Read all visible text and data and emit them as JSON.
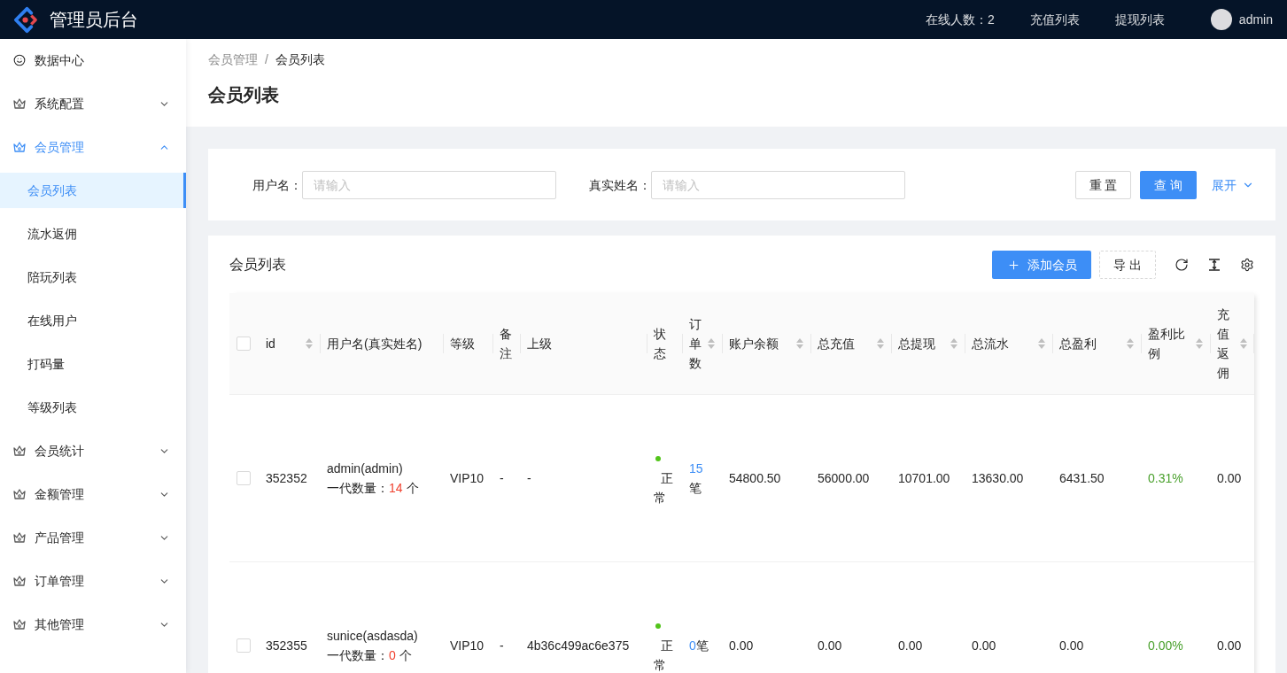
{
  "topbar": {
    "title": "管理员后台",
    "online": "在线人数：2",
    "links": [
      "充值列表",
      "提现列表"
    ],
    "user": "admin"
  },
  "sidebar": {
    "items": [
      {
        "kind": "link",
        "label": "数据中心",
        "selected": false
      },
      {
        "kind": "group",
        "label": "系统配置",
        "expanded": false
      },
      {
        "kind": "group",
        "label": "会员管理",
        "expanded": true,
        "children": [
          {
            "label": "会员列表",
            "selected": true
          },
          {
            "label": "流水返佣",
            "selected": false
          },
          {
            "label": "陪玩列表",
            "selected": false
          },
          {
            "label": "在线用户",
            "selected": false
          },
          {
            "label": "打码量",
            "selected": false
          },
          {
            "label": "等级列表",
            "selected": false
          }
        ]
      },
      {
        "kind": "group",
        "label": "会员统计",
        "expanded": false
      },
      {
        "kind": "group",
        "label": "金额管理",
        "expanded": false
      },
      {
        "kind": "group",
        "label": "产品管理",
        "expanded": false
      },
      {
        "kind": "group",
        "label": "订单管理",
        "expanded": false
      },
      {
        "kind": "group",
        "label": "其他管理",
        "expanded": false
      }
    ]
  },
  "breadcrumb": {
    "separator": "/",
    "items": [
      "会员管理",
      "会员列表"
    ]
  },
  "page_title": "会员列表",
  "search": {
    "fields": [
      {
        "label": "用户名：",
        "placeholder": "请输入"
      },
      {
        "label": "真实姓名：",
        "placeholder": "请输入"
      }
    ],
    "reset": "重 置",
    "submit": "查 询",
    "expand": "展开"
  },
  "table": {
    "title": "会员列表",
    "add_button": "添加会员",
    "export_button": "导 出",
    "select_all": false,
    "columns": [
      {
        "label": "id",
        "sortable": true
      },
      {
        "label": "用户名(真实姓名)",
        "sortable": false
      },
      {
        "label": "等级",
        "sortable": false
      },
      {
        "label": "备注",
        "sortable": false
      },
      {
        "label": "上级",
        "sortable": false
      },
      {
        "label": "状态",
        "sortable": false
      },
      {
        "label": "订单数",
        "sortable": true
      },
      {
        "label": "账户余额",
        "sortable": true
      },
      {
        "label": "总充值",
        "sortable": true
      },
      {
        "label": "总提现",
        "sortable": true
      },
      {
        "label": "总流水",
        "sortable": true
      },
      {
        "label": "总盈利",
        "sortable": true
      },
      {
        "label": "盈利比例",
        "sortable": true
      },
      {
        "label": "充值返佣",
        "sortable": true
      }
    ],
    "rows": [
      {
        "checked": false,
        "id": "352352",
        "username": "admin(admin)",
        "count_label": "一代数量：",
        "count": "14",
        "count_unit": "个",
        "level": "VIP10",
        "remark": "-",
        "parent": "-",
        "status": {
          "label": "正常",
          "color": "#52c41a"
        },
        "orders": "15",
        "orders_unit": "笔",
        "balance": "54800.50",
        "recharge": "56000.00",
        "withdraw": "10701.00",
        "flow": "13630.00",
        "profit": "6431.50",
        "ratio": "0.31%",
        "rebate": "0.00"
      },
      {
        "checked": false,
        "id": "352355",
        "username": "sunice(asdasda)",
        "count_label": "一代数量：",
        "count": "0",
        "count_unit": "个",
        "level": "VIP10",
        "remark": "-",
        "parent": "4b36c499ac6e375",
        "status": {
          "label": "正常",
          "color": "#52c41a"
        },
        "orders": "0",
        "orders_unit": "笔",
        "balance": "0.00",
        "recharge": "0.00",
        "withdraw": "0.00",
        "flow": "0.00",
        "profit": "0.00",
        "ratio": "0.00%",
        "rebate": "0.00"
      }
    ]
  }
}
